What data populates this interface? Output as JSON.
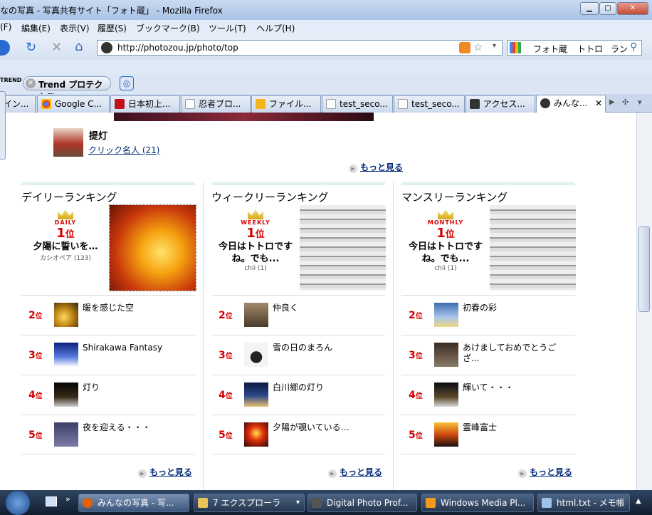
{
  "window": {
    "title": "なの写真 - 写真共有サイト「フォト蔵」 - Mozilla Firefox"
  },
  "menu": [
    "(F)",
    "編集(E)",
    "表示(V)",
    "履歴(S)",
    "ブックマーク(B)",
    "ツール(T)",
    "ヘルプ(H)"
  ],
  "url": "http://photozou.jp/photo/top",
  "search": {
    "items": [
      "フォト蔵",
      "トトロ",
      "ラン"
    ]
  },
  "trend": {
    "label": "Trend プロテクト™",
    "logo": "TREND"
  },
  "tabs": [
    "イン...",
    "Google C...",
    "日本初上...",
    "忍者ブロ...",
    "ファイル...",
    "test_seco...",
    "test_seco...",
    "アクセス...",
    "みんな..."
  ],
  "top_user": {
    "name": "提灯",
    "link": "クリック名人 (21)"
  },
  "more_label": "もっと見る",
  "rankings": [
    {
      "title": "デイリーランキング",
      "badge": "DAILY",
      "rank_label": "1",
      "rank_suffix": "位",
      "top_title": "夕陽に誓いを…",
      "top_by": "カシオペア (123)",
      "items": [
        {
          "rank": "2",
          "title": "暖を感じた空"
        },
        {
          "rank": "3",
          "title": "Shirakawa Fantasy"
        },
        {
          "rank": "4",
          "title": "灯り"
        },
        {
          "rank": "5",
          "title": "夜を迎える・・・"
        }
      ]
    },
    {
      "title": "ウィークリーランキング",
      "badge": "WEEKLY",
      "rank_label": "1",
      "rank_suffix": "位",
      "top_title": "今日はトトロですね。でも...",
      "top_by": "chii (1)",
      "items": [
        {
          "rank": "2",
          "title": "仲良く"
        },
        {
          "rank": "3",
          "title": "雪の日のまろん"
        },
        {
          "rank": "4",
          "title": "白川郷の灯り"
        },
        {
          "rank": "5",
          "title": "夕陽が覗いている…"
        }
      ]
    },
    {
      "title": "マンスリーランキング",
      "badge": "MONTHLY",
      "rank_label": "1",
      "rank_suffix": "位",
      "top_title": "今日はトトロですね。でも...",
      "top_by": "chii (1)",
      "items": [
        {
          "rank": "2",
          "title": "初春の彩"
        },
        {
          "rank": "3",
          "title": "あけましておめでとうござ..."
        },
        {
          "rank": "4",
          "title": "輝いて・・・"
        },
        {
          "rank": "5",
          "title": "霊峰富士"
        }
      ]
    }
  ],
  "taskbar": [
    "みんなの写真 - 写...",
    "7 エクスプローラ",
    "Digital Photo Prof...",
    "Windows Media Pl...",
    "html.txt - メモ帳"
  ],
  "rank_suffix_small": "位"
}
